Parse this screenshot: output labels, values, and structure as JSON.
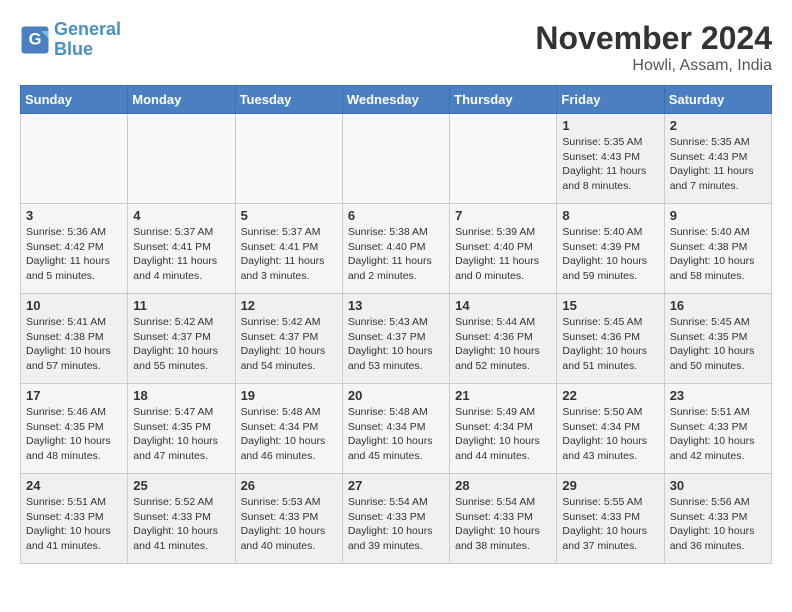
{
  "header": {
    "logo_line1": "General",
    "logo_line2": "Blue",
    "month": "November 2024",
    "location": "Howli, Assam, India"
  },
  "weekdays": [
    "Sunday",
    "Monday",
    "Tuesday",
    "Wednesday",
    "Thursday",
    "Friday",
    "Saturday"
  ],
  "weeks": [
    [
      {
        "day": "",
        "info": ""
      },
      {
        "day": "",
        "info": ""
      },
      {
        "day": "",
        "info": ""
      },
      {
        "day": "",
        "info": ""
      },
      {
        "day": "",
        "info": ""
      },
      {
        "day": "1",
        "info": "Sunrise: 5:35 AM\nSunset: 4:43 PM\nDaylight: 11 hours and 8 minutes."
      },
      {
        "day": "2",
        "info": "Sunrise: 5:35 AM\nSunset: 4:43 PM\nDaylight: 11 hours and 7 minutes."
      }
    ],
    [
      {
        "day": "3",
        "info": "Sunrise: 5:36 AM\nSunset: 4:42 PM\nDaylight: 11 hours and 5 minutes."
      },
      {
        "day": "4",
        "info": "Sunrise: 5:37 AM\nSunset: 4:41 PM\nDaylight: 11 hours and 4 minutes."
      },
      {
        "day": "5",
        "info": "Sunrise: 5:37 AM\nSunset: 4:41 PM\nDaylight: 11 hours and 3 minutes."
      },
      {
        "day": "6",
        "info": "Sunrise: 5:38 AM\nSunset: 4:40 PM\nDaylight: 11 hours and 2 minutes."
      },
      {
        "day": "7",
        "info": "Sunrise: 5:39 AM\nSunset: 4:40 PM\nDaylight: 11 hours and 0 minutes."
      },
      {
        "day": "8",
        "info": "Sunrise: 5:40 AM\nSunset: 4:39 PM\nDaylight: 10 hours and 59 minutes."
      },
      {
        "day": "9",
        "info": "Sunrise: 5:40 AM\nSunset: 4:38 PM\nDaylight: 10 hours and 58 minutes."
      }
    ],
    [
      {
        "day": "10",
        "info": "Sunrise: 5:41 AM\nSunset: 4:38 PM\nDaylight: 10 hours and 57 minutes."
      },
      {
        "day": "11",
        "info": "Sunrise: 5:42 AM\nSunset: 4:37 PM\nDaylight: 10 hours and 55 minutes."
      },
      {
        "day": "12",
        "info": "Sunrise: 5:42 AM\nSunset: 4:37 PM\nDaylight: 10 hours and 54 minutes."
      },
      {
        "day": "13",
        "info": "Sunrise: 5:43 AM\nSunset: 4:37 PM\nDaylight: 10 hours and 53 minutes."
      },
      {
        "day": "14",
        "info": "Sunrise: 5:44 AM\nSunset: 4:36 PM\nDaylight: 10 hours and 52 minutes."
      },
      {
        "day": "15",
        "info": "Sunrise: 5:45 AM\nSunset: 4:36 PM\nDaylight: 10 hours and 51 minutes."
      },
      {
        "day": "16",
        "info": "Sunrise: 5:45 AM\nSunset: 4:35 PM\nDaylight: 10 hours and 50 minutes."
      }
    ],
    [
      {
        "day": "17",
        "info": "Sunrise: 5:46 AM\nSunset: 4:35 PM\nDaylight: 10 hours and 48 minutes."
      },
      {
        "day": "18",
        "info": "Sunrise: 5:47 AM\nSunset: 4:35 PM\nDaylight: 10 hours and 47 minutes."
      },
      {
        "day": "19",
        "info": "Sunrise: 5:48 AM\nSunset: 4:34 PM\nDaylight: 10 hours and 46 minutes."
      },
      {
        "day": "20",
        "info": "Sunrise: 5:48 AM\nSunset: 4:34 PM\nDaylight: 10 hours and 45 minutes."
      },
      {
        "day": "21",
        "info": "Sunrise: 5:49 AM\nSunset: 4:34 PM\nDaylight: 10 hours and 44 minutes."
      },
      {
        "day": "22",
        "info": "Sunrise: 5:50 AM\nSunset: 4:34 PM\nDaylight: 10 hours and 43 minutes."
      },
      {
        "day": "23",
        "info": "Sunrise: 5:51 AM\nSunset: 4:33 PM\nDaylight: 10 hours and 42 minutes."
      }
    ],
    [
      {
        "day": "24",
        "info": "Sunrise: 5:51 AM\nSunset: 4:33 PM\nDaylight: 10 hours and 41 minutes."
      },
      {
        "day": "25",
        "info": "Sunrise: 5:52 AM\nSunset: 4:33 PM\nDaylight: 10 hours and 41 minutes."
      },
      {
        "day": "26",
        "info": "Sunrise: 5:53 AM\nSunset: 4:33 PM\nDaylight: 10 hours and 40 minutes."
      },
      {
        "day": "27",
        "info": "Sunrise: 5:54 AM\nSunset: 4:33 PM\nDaylight: 10 hours and 39 minutes."
      },
      {
        "day": "28",
        "info": "Sunrise: 5:54 AM\nSunset: 4:33 PM\nDaylight: 10 hours and 38 minutes."
      },
      {
        "day": "29",
        "info": "Sunrise: 5:55 AM\nSunset: 4:33 PM\nDaylight: 10 hours and 37 minutes."
      },
      {
        "day": "30",
        "info": "Sunrise: 5:56 AM\nSunset: 4:33 PM\nDaylight: 10 hours and 36 minutes."
      }
    ]
  ]
}
